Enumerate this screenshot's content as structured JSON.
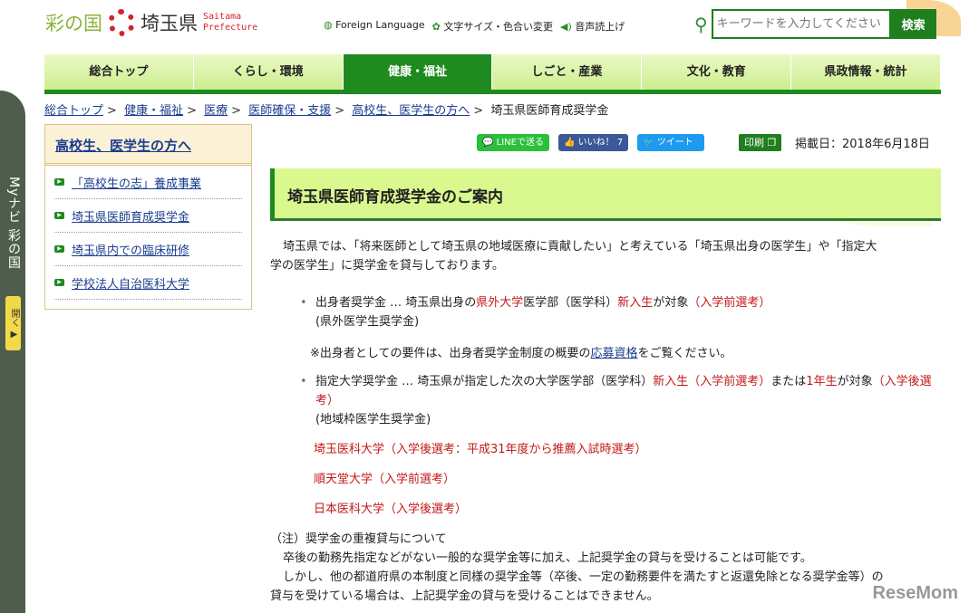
{
  "header": {
    "logo_ayanokuni": "彩の国",
    "logo_pref": "埼玉県",
    "logo_en1": "Saitama",
    "logo_en2": "Prefecture",
    "util": [
      "Foreign Language",
      "文字サイズ・色合い変更",
      "音声読上げ"
    ],
    "search_placeholder": "キーワードを入力してください",
    "search_button": "検索"
  },
  "nav": [
    "総合トップ",
    "くらし・環境",
    "健康・福祉",
    "しごと・産業",
    "文化・教育",
    "県政情報・統計"
  ],
  "breadcrumb": [
    "総合トップ",
    "健康・福祉",
    "医療",
    "医師確保・支援",
    "高校生、医学生の方へ"
  ],
  "breadcrumb_current": "埼玉県医師育成奨学金",
  "mynavi": {
    "label": "Myナビ 彩の国",
    "open": "開く ▶"
  },
  "sidebar": {
    "title": "高校生、医学生の方へ",
    "items": [
      "「高校生の志」養成事業",
      "埼玉県医師育成奨学金",
      "埼玉県内での臨床研修",
      "学校法人自治医科大学"
    ]
  },
  "share": {
    "line": "LINEで送る",
    "like": "いいね！ 7",
    "tweet": "ツイート",
    "print": "印刷",
    "date": "掲載日：2018年6月18日"
  },
  "title": "埼玉県医師育成奨学金のご案内",
  "body": {
    "intro1": "埼玉県では、「将来医師として埼玉県の地域医療に貢献したい」と考えている「埼玉県出身の医学生」や「指定大",
    "intro2": "学の医学生」に奨学金を貸与しております。",
    "b1": [
      "出身者奨学金 … 埼玉県出身の",
      "県外大学",
      "医学部（医学科）",
      "新入生",
      "が対象",
      "（入学前選考）"
    ],
    "b1_sub": "(県外医学生奨学金)",
    "note_pre": "※出身者としての要件は、出身者奨学金制度の概要の",
    "note_link": "応募資格",
    "note_post": "をご覧ください。",
    "b2": [
      "指定大学奨学金 … 埼玉県が指定した次の大学医学部（医学科）",
      "新入生（入学前選考）",
      "または",
      "1年生",
      "が対象",
      "（入学後選考）"
    ],
    "b2_sub": "(地域枠医学生奨学金)",
    "universities": [
      "埼玉医科大学（入学後選考：平成31年度から推薦入試時選考）",
      "順天堂大学（入学前選考）",
      "日本医科大学（入学後選考）"
    ],
    "caution_title": "（注）奨学金の重複貸与について",
    "caution1": "卒後の勤務先指定などがない一般的な奨学金等に加え、上記奨学金の貸与を受けることは可能です。",
    "caution2": "しかし、他の都道府県の本制度と同様の奨学金等（卒後、一定の勤務要件を満たすと返還免除となる奨学金等）の",
    "caution3": "貸与を受けている場合は、上記奨学金の貸与を受けることはできません。"
  },
  "watermark": "ReseMom"
}
